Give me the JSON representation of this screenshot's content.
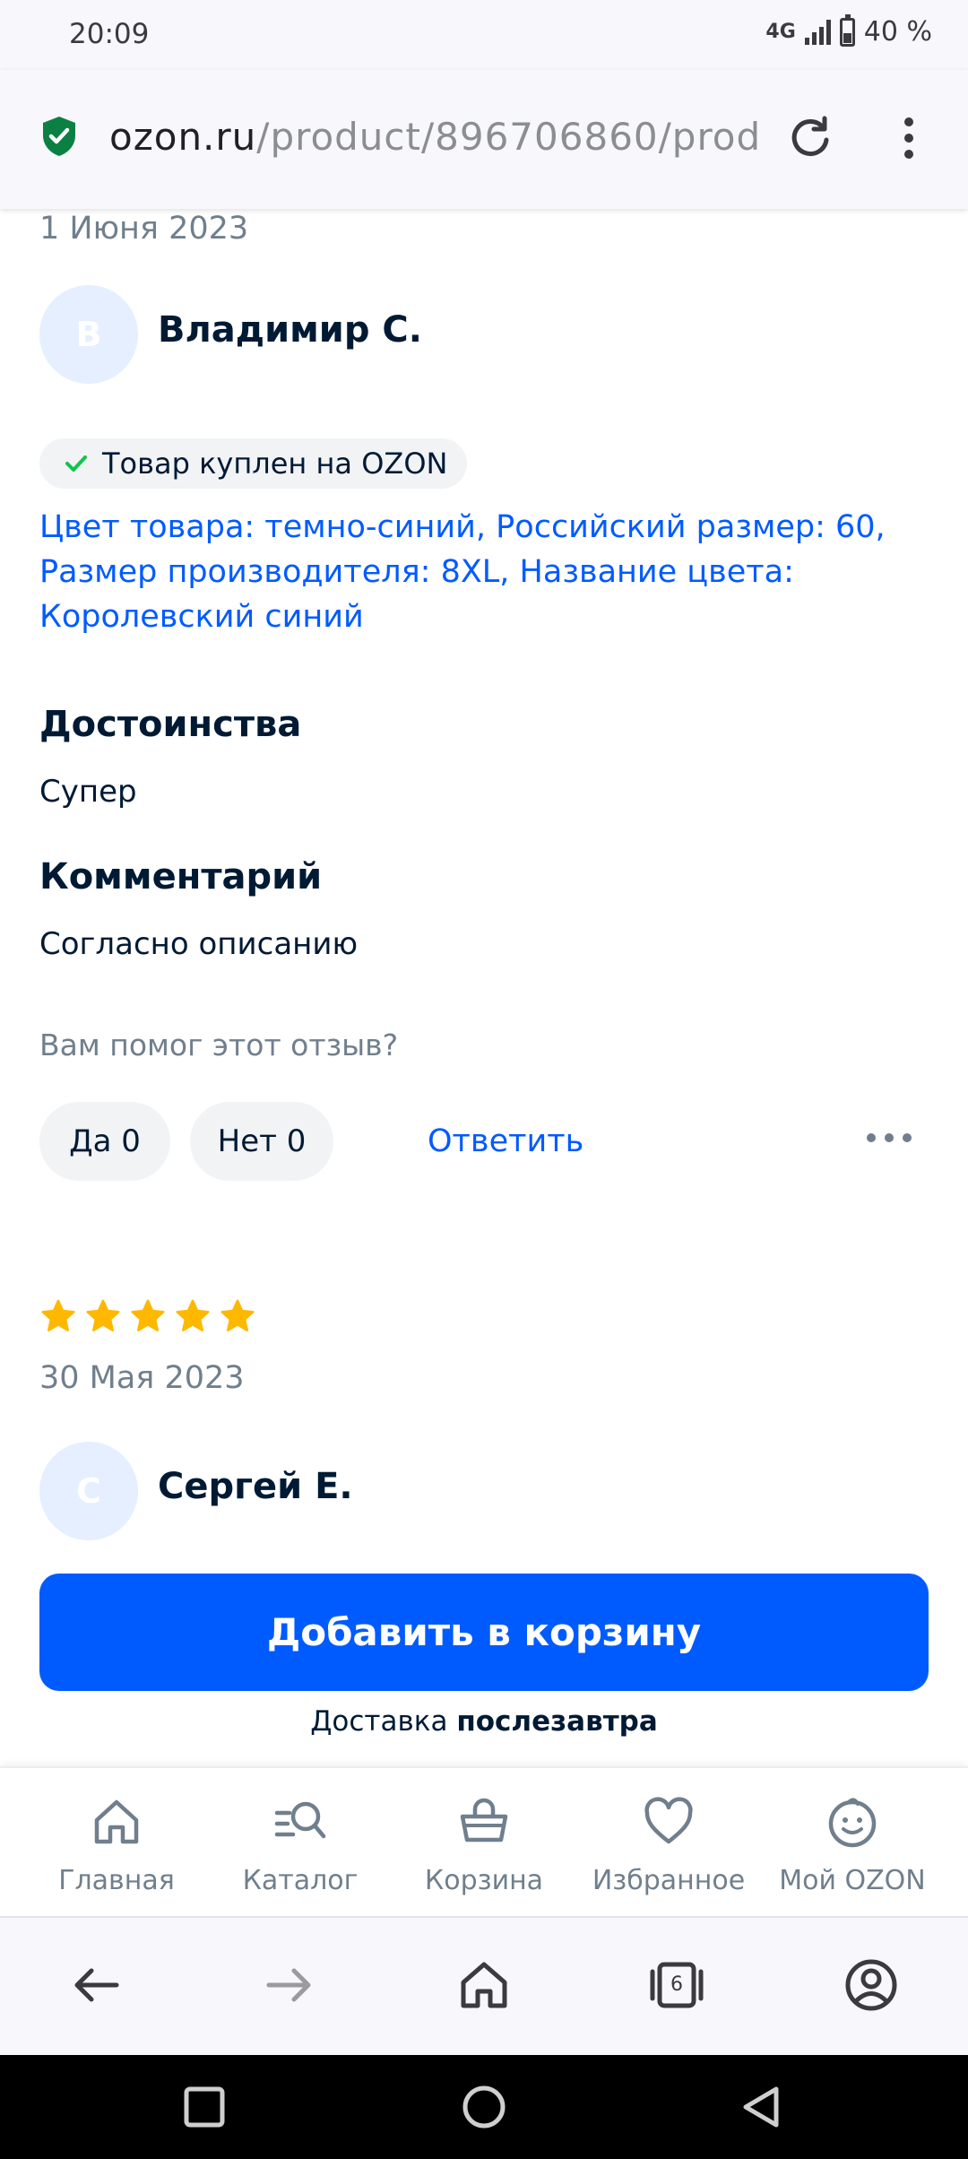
{
  "status_bar": {
    "time": "20:09",
    "network": "4G",
    "battery": "40 %"
  },
  "browser": {
    "url_host": "ozon.ru",
    "url_path": "/product/896706860/product"
  },
  "review1": {
    "date": "1 Июня 2023",
    "avatar_letter": "В",
    "author": "Владимир С.",
    "bought_badge": "Товар куплен на OZON",
    "variant": "Цвет товара: темно-синий, Российский размер: 60, Размер производителя: 8XL, Название цвета: Королевский синий",
    "pros_title": "Достоинства",
    "pros_text": "Супер",
    "comment_title": "Комментарий",
    "comment_text": "Согласно описанию",
    "helpful_question": "Вам помог этот отзыв?",
    "yes_label": "Да 0",
    "no_label": "Нет 0",
    "reply_label": "Ответить"
  },
  "review2": {
    "rating": 5,
    "date": "30 Мая 2023",
    "avatar_letter": "С",
    "author": "Сергей Е."
  },
  "cart": {
    "button_label": "Добавить в корзину",
    "delivery_prefix": "Доставка",
    "delivery_when": "послезавтра"
  },
  "tabs": [
    {
      "label": "Главная",
      "icon": "home-icon"
    },
    {
      "label": "Каталог",
      "icon": "catalog-search-icon"
    },
    {
      "label": "Корзина",
      "icon": "basket-icon"
    },
    {
      "label": "Избранное",
      "icon": "heart-icon"
    },
    {
      "label": "Мой OZON",
      "icon": "smiley-icon"
    }
  ],
  "browser_toolbar": {
    "tab_count": "6"
  },
  "colors": {
    "brand_blue": "#005bff",
    "star": "#ffb800",
    "text_dark": "#001a34",
    "text_gray": "#707f8d"
  }
}
